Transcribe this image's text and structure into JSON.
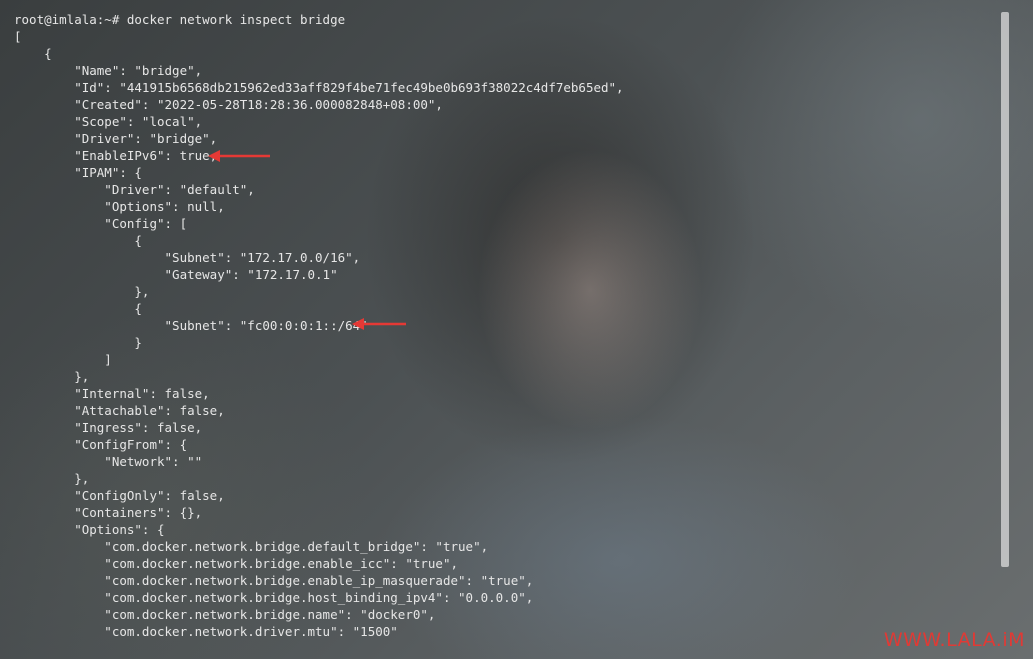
{
  "terminal": {
    "lines": [
      "root@imlala:~# docker network inspect bridge",
      "[",
      "    {",
      "        \"Name\": \"bridge\",",
      "        \"Id\": \"441915b6568db215962ed33aff829f4be71fec49be0b693f38022c4df7eb65ed\",",
      "        \"Created\": \"2022-05-28T18:28:36.000082848+08:00\",",
      "        \"Scope\": \"local\",",
      "        \"Driver\": \"bridge\",",
      "        \"EnableIPv6\": true,",
      "        \"IPAM\": {",
      "            \"Driver\": \"default\",",
      "            \"Options\": null,",
      "            \"Config\": [",
      "                {",
      "                    \"Subnet\": \"172.17.0.0/16\",",
      "                    \"Gateway\": \"172.17.0.1\"",
      "                },",
      "                {",
      "                    \"Subnet\": \"fc00:0:0:1::/64\"",
      "                }",
      "            ]",
      "        },",
      "        \"Internal\": false,",
      "        \"Attachable\": false,",
      "        \"Ingress\": false,",
      "        \"ConfigFrom\": {",
      "            \"Network\": \"\"",
      "        },",
      "        \"ConfigOnly\": false,",
      "        \"Containers\": {},",
      "        \"Options\": {",
      "            \"com.docker.network.bridge.default_bridge\": \"true\",",
      "            \"com.docker.network.bridge.enable_icc\": \"true\",",
      "            \"com.docker.network.bridge.enable_ip_masquerade\": \"true\",",
      "            \"com.docker.network.bridge.host_binding_ipv4\": \"0.0.0.0\",",
      "            \"com.docker.network.bridge.name\": \"docker0\",",
      "            \"com.docker.network.driver.mtu\": \"1500\""
    ]
  },
  "annotations": {
    "arrow_color": "#e53935"
  },
  "watermark": {
    "text": "WWW.LALA.iM"
  },
  "colors": {
    "text": "#e6e6e6",
    "watermark": "#e03a35"
  }
}
